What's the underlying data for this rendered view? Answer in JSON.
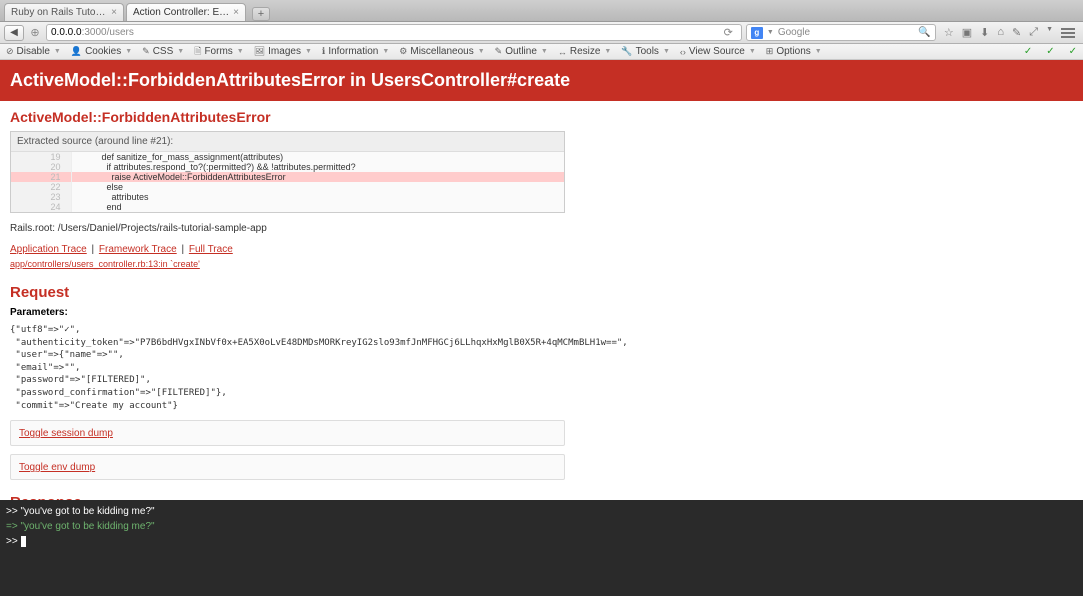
{
  "browser": {
    "tabs": [
      {
        "title": "Ruby on Rails Tutorial Sample ...",
        "active": false
      },
      {
        "title": "Action Controller: Exception c...",
        "active": true
      }
    ],
    "url_host": "0.0.0.0",
    "url_port": ":3000",
    "url_path": "/users",
    "search_placeholder": "Google"
  },
  "devtoolbar": {
    "items": [
      "Disable",
      "Cookies",
      "CSS",
      "Forms",
      "Images",
      "Information",
      "Miscellaneous",
      "Outline",
      "Resize",
      "Tools",
      "View Source",
      "Options"
    ]
  },
  "error": {
    "banner": "ActiveModel::ForbiddenAttributesError in UsersController#create",
    "title": "ActiveModel::ForbiddenAttributesError",
    "extracted_label": "Extracted source (around line #21):",
    "code": [
      {
        "ln": "19",
        "text": "def sanitize_for_mass_assignment(attributes)"
      },
      {
        "ln": "20",
        "text": "  if attributes.respond_to?(:permitted?) && !attributes.permitted?"
      },
      {
        "ln": "21",
        "text": "    raise ActiveModel::ForbiddenAttributesError",
        "hl": true
      },
      {
        "ln": "22",
        "text": "  else"
      },
      {
        "ln": "23",
        "text": "    attributes"
      },
      {
        "ln": "24",
        "text": "  end"
      }
    ],
    "rails_root_label": "Rails.root: ",
    "rails_root_path": "/Users/Daniel/Projects/rails-tutorial-sample-app",
    "trace_links": {
      "app": "Application Trace",
      "framework": "Framework Trace",
      "full": "Full Trace"
    },
    "trace_line": "app/controllers/users_controller.rb:13:in `create'"
  },
  "request": {
    "header": "Request",
    "params_label": "Parameters:",
    "params_dump": "{\"utf8\"=>\"✓\",\n \"authenticity_token\"=>\"P7B6bdHVgxINbVf0x+EA5X0oLvE48DMDsMORKreyIG2slo93mfJnMFHGCj6LLhqxHxMglB0X5R+4qMCMmBLH1w==\",\n \"user\"=>{\"name\"=>\"\",\n \"email\"=>\"\",\n \"password\"=>\"[FILTERED]\",\n \"password_confirmation\"=>\"[FILTERED]\"},\n \"commit\"=>\"Create my account\"}",
    "toggles": {
      "session": "Toggle session dump",
      "env": "Toggle env dump"
    }
  },
  "response": {
    "header": "Response"
  },
  "console": {
    "line1_prompt": ">> ",
    "line1_text": "\"you've got to be kidding me?\"",
    "line2_prompt": "=> ",
    "line2_text": "\"you've got to be kidding me?\"",
    "line3_prompt": ">> "
  }
}
